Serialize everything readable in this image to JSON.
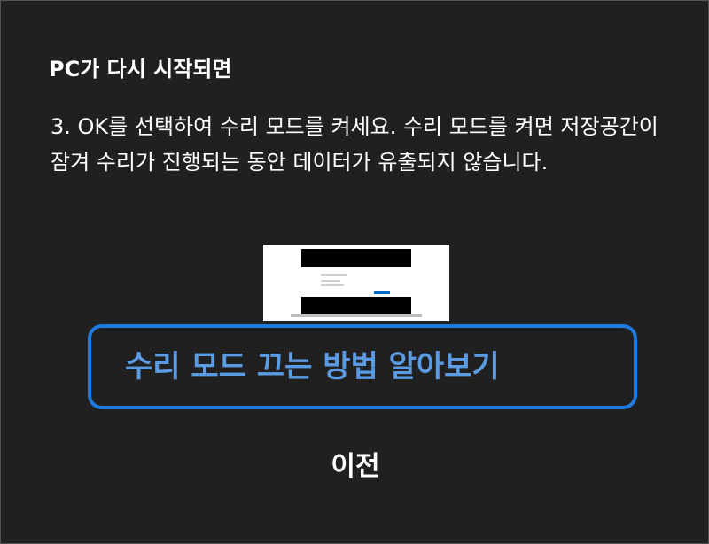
{
  "heading": "PC가 다시 시작되면",
  "body": "3. OK를 선택하여 수리 모드를 켜세요. 수리 모드를 켜면 저장공간이 잠겨 수리가 진행되는 동안 데이터가 유출되지 않습니다.",
  "illustration": {
    "icon": "laptop-icon",
    "accent_color": "#0067c0"
  },
  "learn_link": {
    "label": "수리 모드 끄는 방법 알아보기",
    "border_color": "#1f7ae0",
    "text_color": "#5b9be3"
  },
  "previous_button": {
    "label": "이전"
  },
  "colors": {
    "background": "#202020",
    "text": "#ffffff"
  }
}
